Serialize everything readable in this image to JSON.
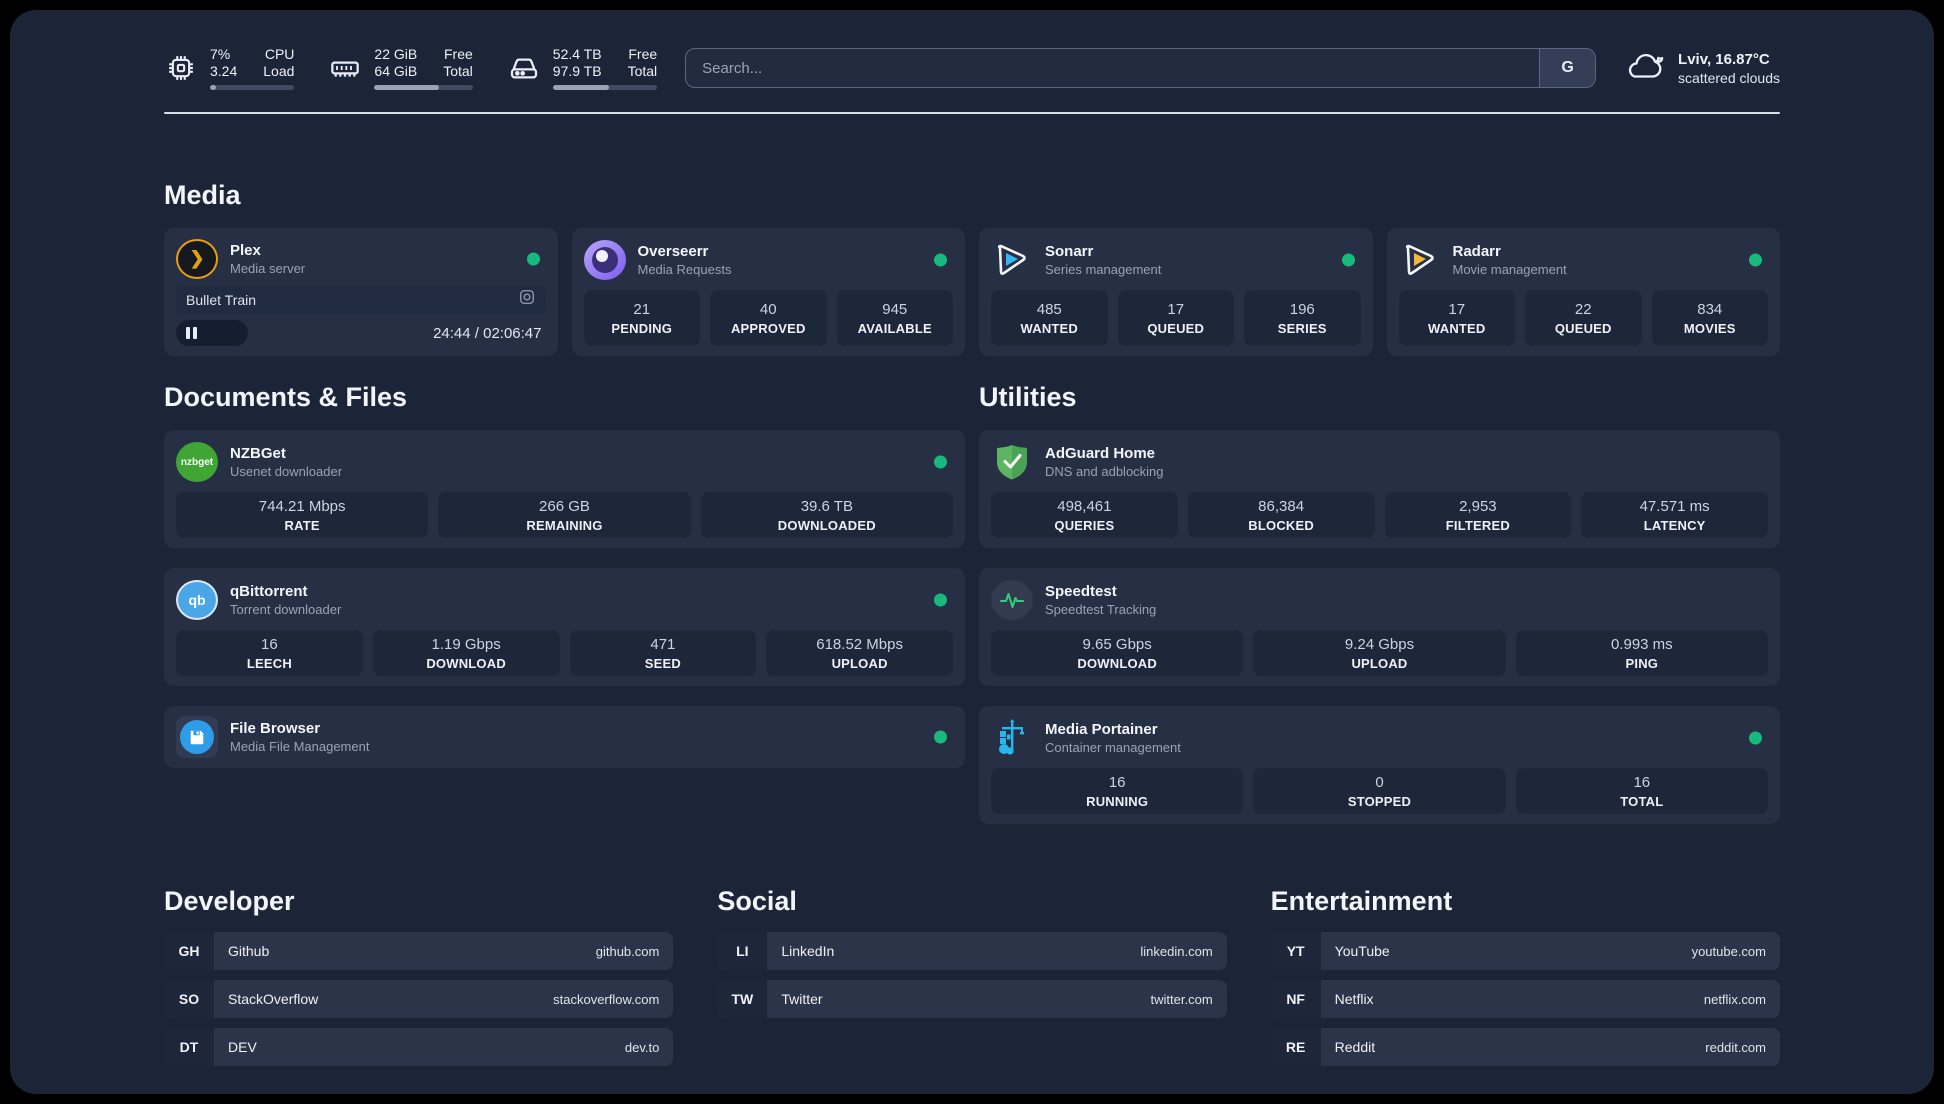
{
  "colors": {
    "accent-green": "#18b97d",
    "bar-fill": "#9aa3b5",
    "panel": "#1c2437",
    "card": "#272f44",
    "tile": "#1e2639"
  },
  "header": {
    "metrics": [
      {
        "icon": "cpu-icon",
        "line1a": "7%",
        "line2a": "3.24",
        "line1b": "CPU",
        "line2b": "Load",
        "progress_pct": 7
      },
      {
        "icon": "ram-icon",
        "line1a": "22 GiB",
        "line2a": "64 GiB",
        "line1b": "Free",
        "line2b": "Total",
        "progress_pct": 66
      },
      {
        "icon": "disk-icon",
        "line1a": "52.4 TB",
        "line2a": "97.9 TB",
        "line1b": "Free",
        "line2b": "Total",
        "progress_pct": 54
      }
    ],
    "search": {
      "placeholder": "Search...",
      "engine": "G"
    },
    "weather": {
      "location_temp": "Lviv, 16.87°C",
      "condition": "scattered clouds"
    }
  },
  "media": {
    "title": "Media",
    "plex": {
      "name": "Plex",
      "subtitle": "Media server",
      "now_playing": {
        "title": "Bullet Train",
        "time": "24:44 / 02:06:47",
        "progress_pct": 19.5
      }
    },
    "apps": [
      {
        "name": "Overseerr",
        "subtitle": "Media Requests",
        "stats": [
          {
            "value": "21",
            "label": "PENDING"
          },
          {
            "value": "40",
            "label": "APPROVED"
          },
          {
            "value": "945",
            "label": "AVAILABLE"
          }
        ]
      },
      {
        "name": "Sonarr",
        "subtitle": "Series management",
        "stats": [
          {
            "value": "485",
            "label": "WANTED"
          },
          {
            "value": "17",
            "label": "QUEUED"
          },
          {
            "value": "196",
            "label": "SERIES"
          }
        ]
      },
      {
        "name": "Radarr",
        "subtitle": "Movie management",
        "stats": [
          {
            "value": "17",
            "label": "WANTED"
          },
          {
            "value": "22",
            "label": "QUEUED"
          },
          {
            "value": "834",
            "label": "MOVIES"
          }
        ]
      }
    ]
  },
  "documents": {
    "title": "Documents & Files",
    "apps": [
      {
        "name": "NZBGet",
        "subtitle": "Usenet downloader",
        "icon_text": "nzbget",
        "stats": [
          {
            "value": "744.21 Mbps",
            "label": "RATE"
          },
          {
            "value": "266 GB",
            "label": "REMAINING"
          },
          {
            "value": "39.6 TB",
            "label": "DOWNLOADED"
          }
        ]
      },
      {
        "name": "qBittorrent",
        "subtitle": "Torrent downloader",
        "icon_text": "qb",
        "stats": [
          {
            "value": "16",
            "label": "LEECH"
          },
          {
            "value": "1.19 Gbps",
            "label": "DOWNLOAD"
          },
          {
            "value": "471",
            "label": "SEED"
          },
          {
            "value": "618.52 Mbps",
            "label": "UPLOAD"
          }
        ]
      },
      {
        "name": "File Browser",
        "subtitle": "Media File Management",
        "stats": []
      }
    ]
  },
  "utilities": {
    "title": "Utilities",
    "apps": [
      {
        "name": "AdGuard Home",
        "subtitle": "DNS and adblocking",
        "stats": [
          {
            "value": "498,461",
            "label": "QUERIES"
          },
          {
            "value": "86,384",
            "label": "BLOCKED"
          },
          {
            "value": "2,953",
            "label": "FILTERED"
          },
          {
            "value": "47.571 ms",
            "label": "LATENCY"
          }
        ]
      },
      {
        "name": "Speedtest",
        "subtitle": "Speedtest Tracking",
        "stats": [
          {
            "value": "9.65 Gbps",
            "label": "DOWNLOAD"
          },
          {
            "value": "9.24 Gbps",
            "label": "UPLOAD"
          },
          {
            "value": "0.993 ms",
            "label": "PING"
          }
        ]
      },
      {
        "name": "Media Portainer",
        "subtitle": "Container management",
        "stats": [
          {
            "value": "16",
            "label": "RUNNING"
          },
          {
            "value": "0",
            "label": "STOPPED"
          },
          {
            "value": "16",
            "label": "TOTAL"
          }
        ]
      }
    ]
  },
  "links": {
    "developer": {
      "title": "Developer",
      "items": [
        {
          "abbr": "GH",
          "label": "Github",
          "url": "github.com"
        },
        {
          "abbr": "SO",
          "label": "StackOverflow",
          "url": "stackoverflow.com"
        },
        {
          "abbr": "DT",
          "label": "DEV",
          "url": "dev.to"
        }
      ]
    },
    "social": {
      "title": "Social",
      "items": [
        {
          "abbr": "LI",
          "label": "LinkedIn",
          "url": "linkedin.com"
        },
        {
          "abbr": "TW",
          "label": "Twitter",
          "url": "twitter.com"
        }
      ]
    },
    "entertainment": {
      "title": "Entertainment",
      "items": [
        {
          "abbr": "YT",
          "label": "YouTube",
          "url": "youtube.com"
        },
        {
          "abbr": "NF",
          "label": "Netflix",
          "url": "netflix.com"
        },
        {
          "abbr": "RE",
          "label": "Reddit",
          "url": "reddit.com"
        }
      ]
    }
  }
}
